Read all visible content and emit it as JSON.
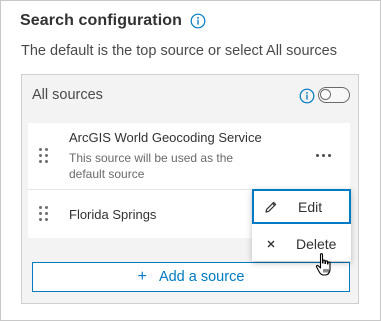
{
  "header": {
    "title": "Search configuration",
    "info_icon": "info-icon",
    "subtitle": "The default is the top source or select All sources"
  },
  "sources_panel": {
    "all_sources_label": "All sources",
    "all_sources_toggle_on": false,
    "items": [
      {
        "name": "ArcGIS World Geocoding Service",
        "description": "This source will be used as the default source",
        "drag_icon": "drag-handle-icon",
        "more_icon": "ellipsis-icon"
      },
      {
        "name": "Florida Springs",
        "drag_icon": "drag-handle-icon"
      }
    ],
    "add_button_label": "Add a source",
    "add_icon": "plus-icon"
  },
  "context_menu": {
    "items": [
      {
        "label": "Edit",
        "icon": "pencil-icon"
      },
      {
        "label": "Delete",
        "icon": "close-icon"
      }
    ]
  },
  "colors": {
    "accent": "#007ac2",
    "text": "#323232",
    "muted_text": "#6a6a6a",
    "panel_bg": "#f3f3f3"
  }
}
